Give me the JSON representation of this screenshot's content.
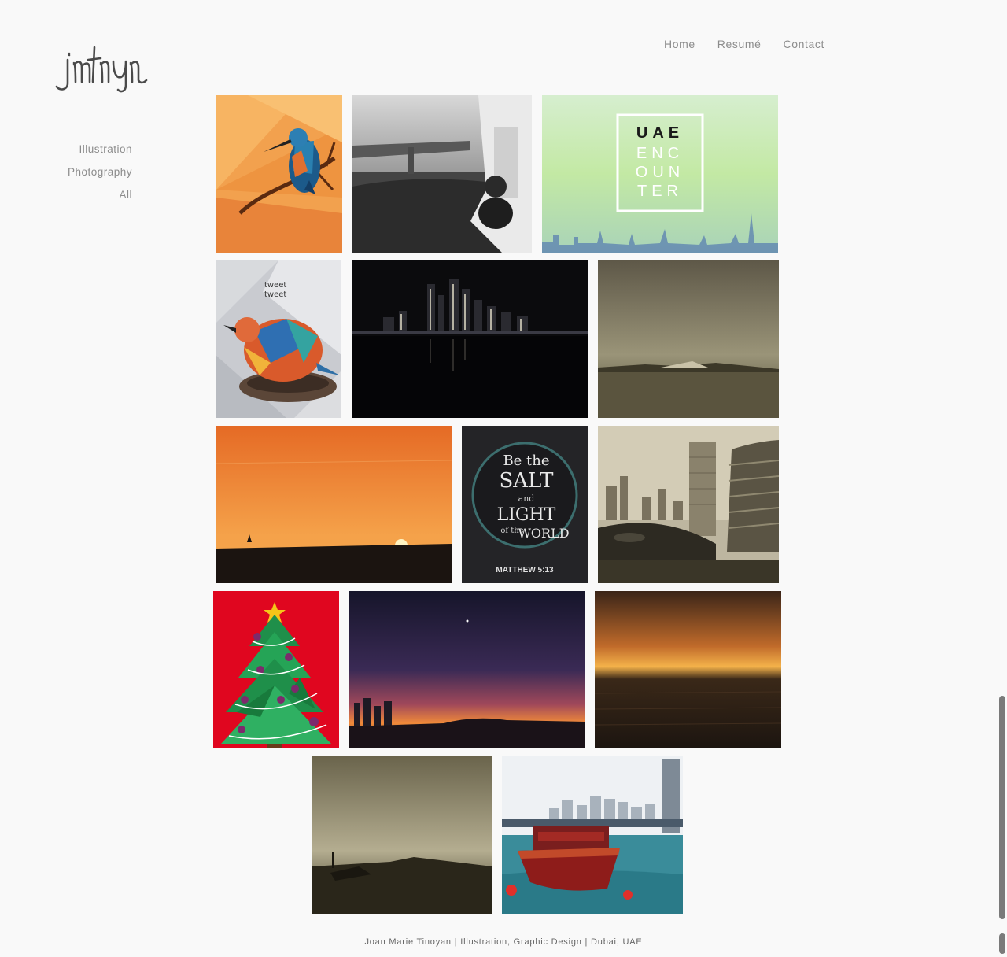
{
  "brand": {
    "logo_text": "jmtnyn"
  },
  "topnav": [
    {
      "label": "Home"
    },
    {
      "label": "Resumé"
    },
    {
      "label": "Contact"
    }
  ],
  "sidenav": [
    {
      "label": "Illustration"
    },
    {
      "label": "Photography"
    },
    {
      "label": "All"
    }
  ],
  "gallery": {
    "tiles": [
      {
        "subject": "kingfisher-illustration"
      },
      {
        "subject": "bw-bridge-boat-photo"
      },
      {
        "subject": "uae-encounter-poster",
        "text_lines": [
          "UAE",
          "ENC",
          "OUN",
          "TER"
        ]
      },
      {
        "subject": "tweet-bird-illustration",
        "text_lines": [
          "tweet",
          "tweet"
        ]
      },
      {
        "subject": "dubai-marina-night-photo"
      },
      {
        "subject": "sepia-sea-yacht-photo"
      },
      {
        "subject": "orange-sunset-walker-photo"
      },
      {
        "subject": "salt-and-light-artwork",
        "text_lines": [
          "Be the",
          "SALT",
          "and",
          "LIGHT",
          "of the",
          "WORLD"
        ],
        "caption": "MATTHEW 5:13"
      },
      {
        "subject": "sepia-marina-towers-photo"
      },
      {
        "subject": "christmas-tree-illustration"
      },
      {
        "subject": "twilight-skyline-photo"
      },
      {
        "subject": "sunset-over-water-photo"
      },
      {
        "subject": "sepia-boat-silhouette-photo"
      },
      {
        "subject": "red-dhow-marina-photo"
      }
    ]
  },
  "footer": {
    "text": "Joan Marie Tinoyan | Illustration, Graphic Design | Dubai, UAE"
  }
}
